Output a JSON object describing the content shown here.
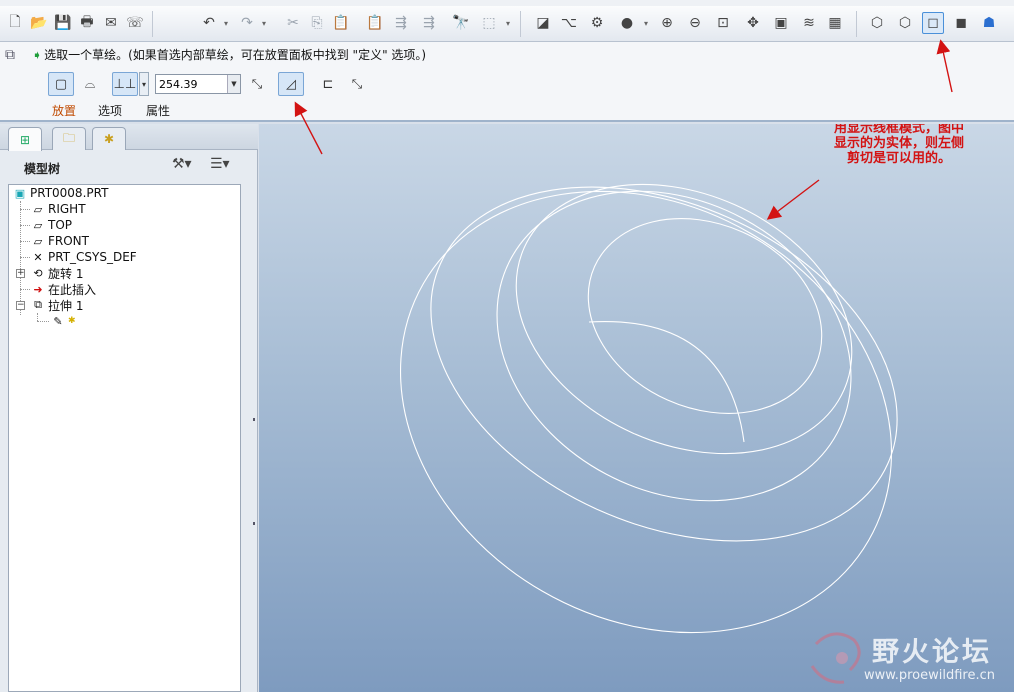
{
  "toolbar": {
    "icons": [
      "new-icon",
      "open-icon",
      "save-icon",
      "print-icon",
      "send-icon",
      "email-icon",
      "undo-icon",
      "redo-icon",
      "cut-icon",
      "copy-icon",
      "paste-icon",
      "paste-special-icon",
      "regenerate-icon",
      "find-icon",
      "select-box-icon",
      "view-mode-icon",
      "datum-icon",
      "spin-center-icon",
      "appearance-icon",
      "zoom-in-icon",
      "zoom-out-icon",
      "refit-icon",
      "reorient-icon",
      "saved-views-icon",
      "layers-icon",
      "view-manager-icon",
      "wireframe-icon",
      "hidden-line-icon",
      "no-hidden-icon",
      "shading-icon",
      "model-tree-icon"
    ]
  },
  "dashboard": {
    "prompt": "选取一个草绘。(如果首选内部草绘，可在放置面板中找到 \"定义\" 选项。)",
    "depth_value": "254.39",
    "tabs": {
      "placement": "放置",
      "options": "选项",
      "properties": "属性"
    }
  },
  "navigator": {
    "title": "模型树",
    "tree": {
      "root": "PRT0008.PRT",
      "right": "RIGHT",
      "top": "TOP",
      "front": "FRONT",
      "csys": "PRT_CSYS_DEF",
      "revolve": "旋转 1",
      "insert_here": "在此插入",
      "extrude": "拉伸 1"
    }
  },
  "graphics": {
    "annotation": [
      "用显示线框模式，图中",
      "显示的为实体，则左侧",
      "剪切是可以用的。"
    ],
    "annotation_color": "#d31313",
    "watermark_title": "野火论坛",
    "watermark_url": "www.proewildfire.cn"
  }
}
